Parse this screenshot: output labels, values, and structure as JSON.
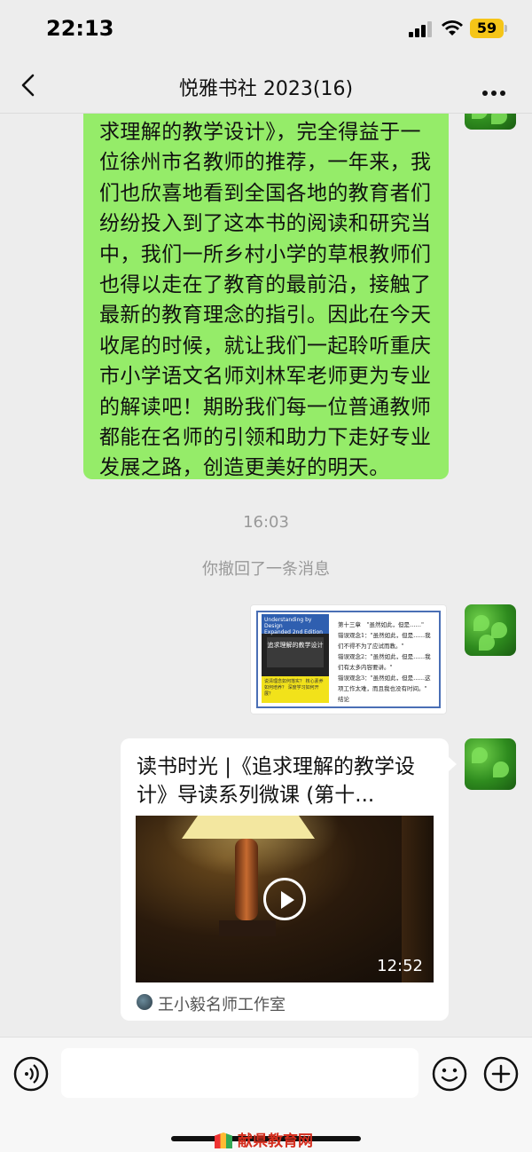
{
  "status_bar": {
    "time": "22:13",
    "battery": "59"
  },
  "nav": {
    "title": "悦雅书社 2023(16)"
  },
  "messages": {
    "green_text": "求理解的教学设计》，完全得益于一位徐州市名教师的推荐，一年来，我们也欣喜地看到全国各地的教育者们纷纷投入到了这本书的阅读和研究当中，我们一所乡村小学的草根教师们也得以走在了教育的最前沿，接触了最新的教育理念的指引。因此在今天收尾的时候，就让我们一起聆听重庆市小学语文名师刘林军老师更为专业的解读吧！期盼我们每一位普通教师都能在名师的引领和助力下走好专业发展之路，创造更美好的明天。",
    "timestamp": "16:03",
    "recall_note": "你撤回了一条消息"
  },
  "image_message": {
    "cover_title_en": "Understanding by Design",
    "cover_subtitle_en": "Expanded 2nd Edition",
    "cover_title_cn": "追求理解的教学设计",
    "cover_bottom": "说清理念如何落实？ 核心素养如何培养？ 深度学习如何开展？",
    "text_lines": [
      "第十三章　\"虽然如此，但是……\"",
      "错误观念1：\"虽然如此，但是……我们不得不为了应试而教。\"",
      "错误观念2：\"虽然如此，但是……我们有太多内容要讲。\"",
      "错误观念3：\"虽然如此，但是……这项工作太难，而且我也没有时间。\"",
      "结论"
    ]
  },
  "link_card": {
    "title": "读书时光 |《追求理解的教学设计》导读系列微课 (第十...",
    "duration": "12:52",
    "source": "王小毅名师工作室"
  },
  "watermark": "献県教育网",
  "colors": {
    "chat_background": "#ededed",
    "sent_bubble": "#95ec69",
    "battery": "#f5c518"
  }
}
